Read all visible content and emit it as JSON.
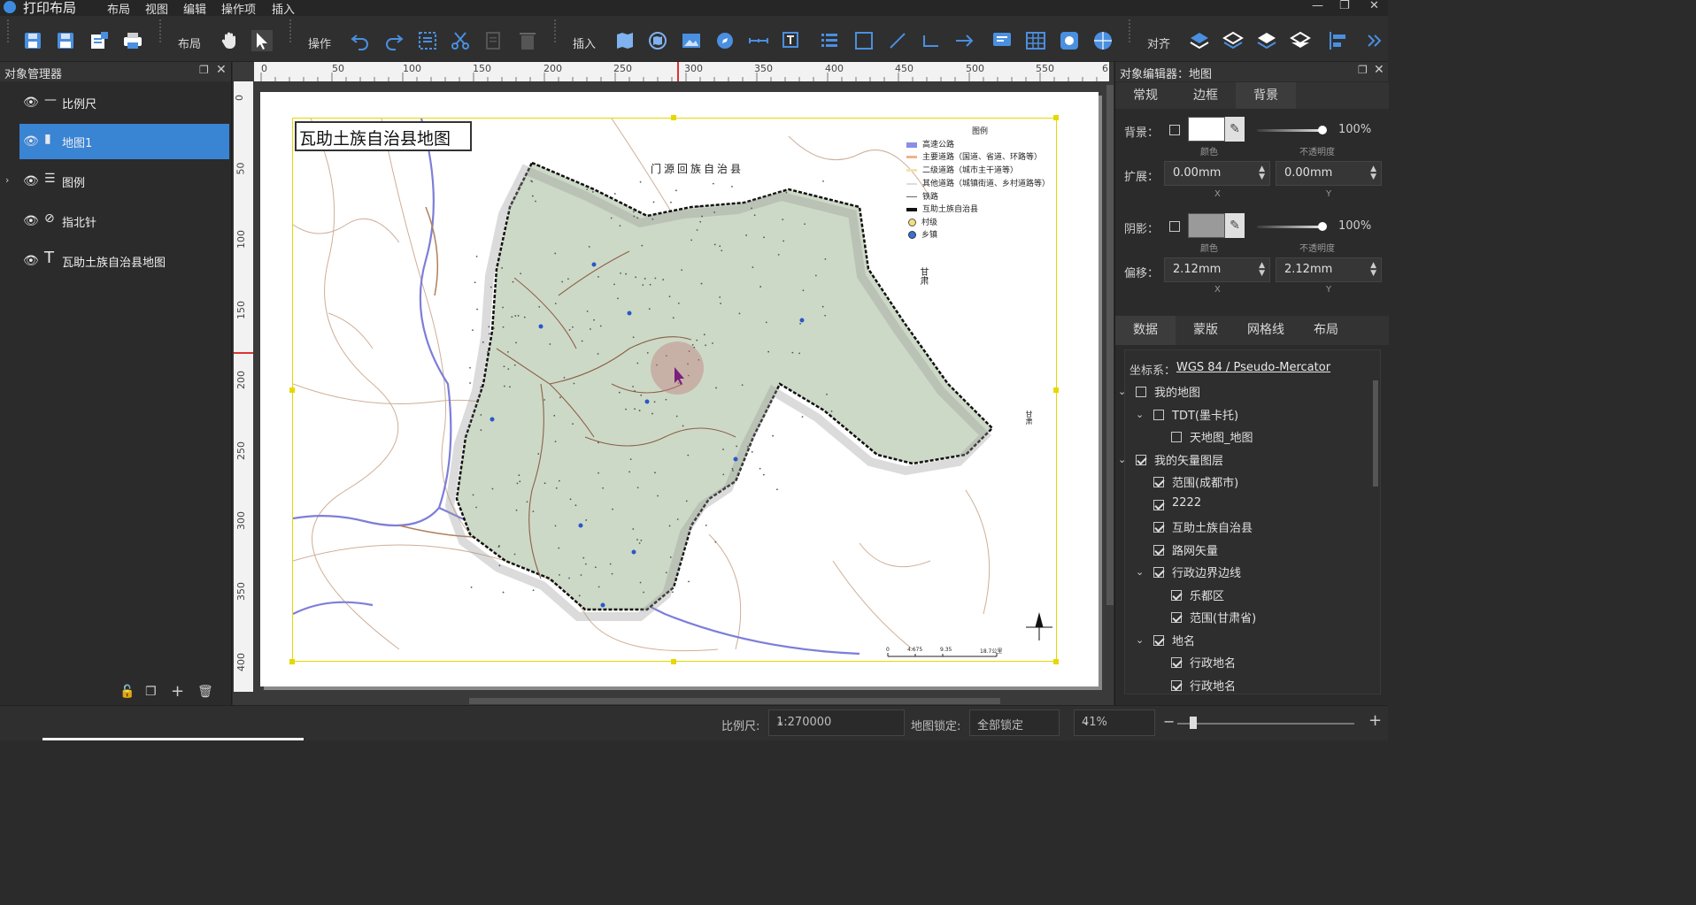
{
  "app": {
    "title": "打印布局"
  },
  "menu": [
    "布局",
    "视图",
    "编辑",
    "操作项",
    "插入"
  ],
  "toolbar": {
    "group_layout": "布局",
    "group_ops": "操作",
    "group_insert": "插入",
    "group_align": "对齐"
  },
  "object_manager": {
    "title": "对象管理器",
    "items": [
      {
        "label": "比例尺",
        "icon": "scalebar-icon"
      },
      {
        "label": "地图1",
        "icon": "map-icon",
        "selected": true
      },
      {
        "label": "图例",
        "icon": "legend-icon"
      },
      {
        "label": "指北针",
        "icon": "compass-icon"
      },
      {
        "label": "瓦助土族自治县地图",
        "icon": "text-icon"
      }
    ]
  },
  "ruler": {
    "top": [
      "0",
      "50",
      "100",
      "150",
      "200",
      "250",
      "300",
      "350",
      "400",
      "450",
      "500",
      "550",
      "6"
    ],
    "left": [
      "0",
      "50",
      "100",
      "150",
      "200",
      "250",
      "300",
      "350",
      "400"
    ]
  },
  "map": {
    "title": "瓦助土族自治县地图",
    "label_north_county": "门源回族自治县",
    "label_east": "甘肃",
    "label_far_east": "甘肃",
    "legend_title": "图例",
    "legend": [
      {
        "label": "高速公路",
        "color": "#8a8ee6"
      },
      {
        "label": "主要道路（国道、省道、环路等）",
        "color": "#f0b38a"
      },
      {
        "label": "二级道路（城市主干道等）",
        "color": "#f3e3b0"
      },
      {
        "label": "其他道路（城镇街道、乡村道路等）",
        "color": "#dddddd"
      },
      {
        "label": "铁路",
        "color": "#666666"
      },
      {
        "label": "互助土族自治县",
        "color": "#111111"
      },
      {
        "label": "村级",
        "color": "#f2e07a"
      },
      {
        "label": "乡镇",
        "color": "#3a6fd8"
      }
    ],
    "scale_ticks": [
      "0",
      "4.675",
      "9.35",
      "18.7公里"
    ]
  },
  "object_editor": {
    "title": "对象编辑器：地图",
    "tabs": [
      "常规",
      "边框",
      "背景"
    ],
    "active_tab": "背景",
    "bg_label": "背景：",
    "bg_color_caption": "颜色",
    "bg_opacity": "100%",
    "opacity_caption": "不透明度",
    "expand_label": "扩展：",
    "expand_x": "0.00mm",
    "expand_y": "0.00mm",
    "x_caption": "X",
    "y_caption": "Y",
    "shadow_label": "阴影：",
    "shadow_color_caption": "颜色",
    "shadow_opacity": "100%",
    "shadow_opacity_caption": "不透明度",
    "offset_label": "偏移：",
    "offset_x": "2.12mm",
    "offset_y": "2.12mm",
    "offset_x_caption": "X",
    "offset_y_caption": "Y",
    "data_tabs": [
      "数据",
      "蒙版",
      "网格线",
      "布局"
    ],
    "active_data_tab": "数据",
    "crs_label": "坐标系：",
    "crs_value": "WGS 84 / Pseudo-Mercator",
    "tree": [
      {
        "label": "我的地图",
        "checked": false,
        "level": 0,
        "expanded": true
      },
      {
        "label": "TDT(墨卡托)",
        "checked": false,
        "level": 1,
        "expanded": true
      },
      {
        "label": "天地图_地图",
        "checked": false,
        "level": 2
      },
      {
        "label": "我的矢量图层",
        "checked": true,
        "level": 0,
        "expanded": true
      },
      {
        "label": "范围(成都市)",
        "checked": true,
        "level": 1
      },
      {
        "label": "2222",
        "checked": true,
        "level": 1
      },
      {
        "label": "互助土族自治县",
        "checked": true,
        "level": 1
      },
      {
        "label": "路网矢量",
        "checked": true,
        "level": 1
      },
      {
        "label": "行政边界边线",
        "checked": true,
        "level": 1,
        "expanded": true
      },
      {
        "label": "乐都区",
        "checked": true,
        "level": 2
      },
      {
        "label": "范围(甘肃省)",
        "checked": true,
        "level": 2
      },
      {
        "label": "地名",
        "checked": true,
        "level": 1,
        "expanded": true
      },
      {
        "label": "行政地名",
        "checked": true,
        "level": 2
      },
      {
        "label": "行政地名",
        "checked": true,
        "level": 2
      }
    ]
  },
  "status": {
    "scale_label": "比例尺:",
    "scale_value": "1:270000",
    "lock_label": "地图锁定:",
    "lock_value": "全部锁定",
    "zoom_value": "41%",
    "zoom_fraction": 0.41
  }
}
